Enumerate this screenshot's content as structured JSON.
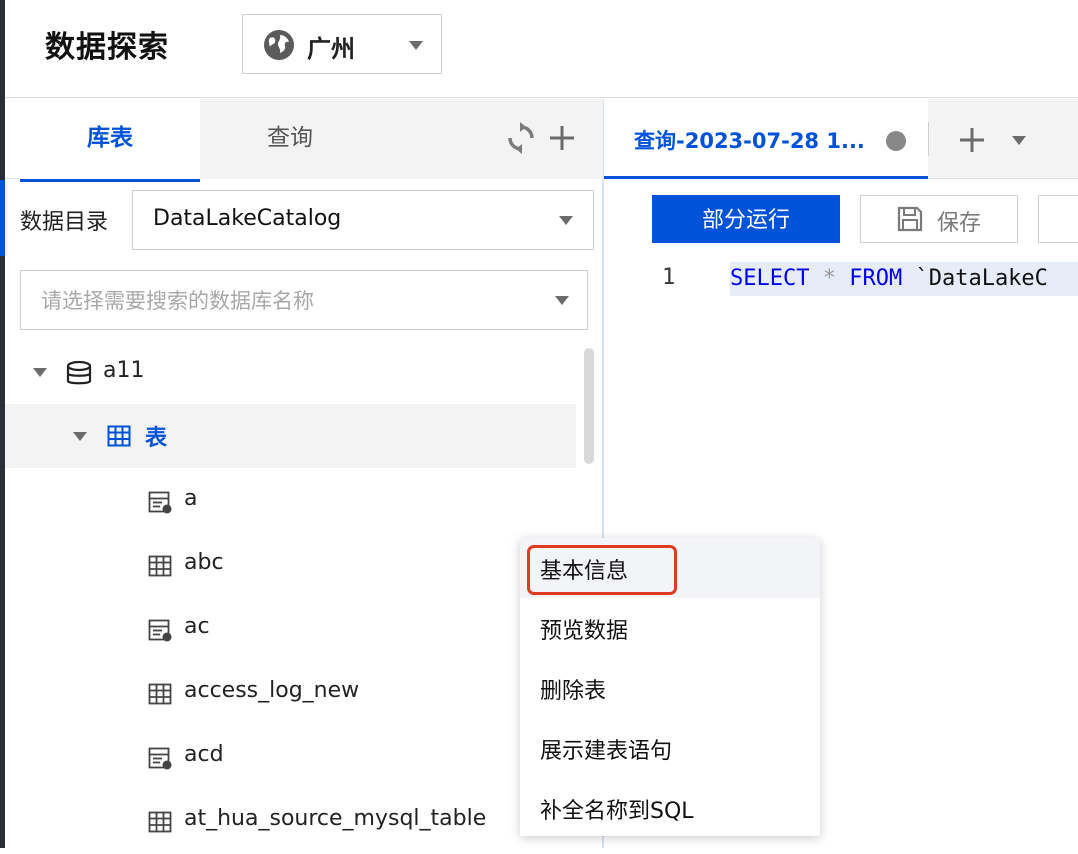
{
  "header": {
    "title": "数据探索",
    "region": "广州"
  },
  "left_panel": {
    "tabs": [
      "库表",
      "查询"
    ],
    "catalog_label": "数据目录",
    "catalog_value": "DataLakeCatalog",
    "db_search_placeholder": "请选择需要搜索的数据库名称",
    "tree": {
      "database": "a11",
      "folder": "表",
      "tables": [
        {
          "name": "a",
          "icon": "view-table-icon"
        },
        {
          "name": "abc",
          "icon": "table-icon"
        },
        {
          "name": "ac",
          "icon": "view-table-icon"
        },
        {
          "name": "access_log_new",
          "icon": "table-icon"
        },
        {
          "name": "acd",
          "icon": "view-table-icon"
        },
        {
          "name": "at_hua_source_mysql_table",
          "icon": "table-icon"
        }
      ]
    }
  },
  "editor": {
    "tab_title": "查询-2023-07-28 1...",
    "run_label": "部分运行",
    "save_label": "保存",
    "line_number": "1",
    "code": {
      "kw1": "SELECT",
      "op": "*",
      "kw2": "FROM",
      "ident": "`DataLakeC"
    }
  },
  "context_menu": {
    "items": [
      "基本信息",
      "预览数据",
      "删除表",
      "展示建表语句",
      "补全名称到SQL"
    ]
  },
  "colors": {
    "accent": "#0052d9",
    "highlight_box": "#e03a22",
    "code_keyword": "#0000ee"
  }
}
